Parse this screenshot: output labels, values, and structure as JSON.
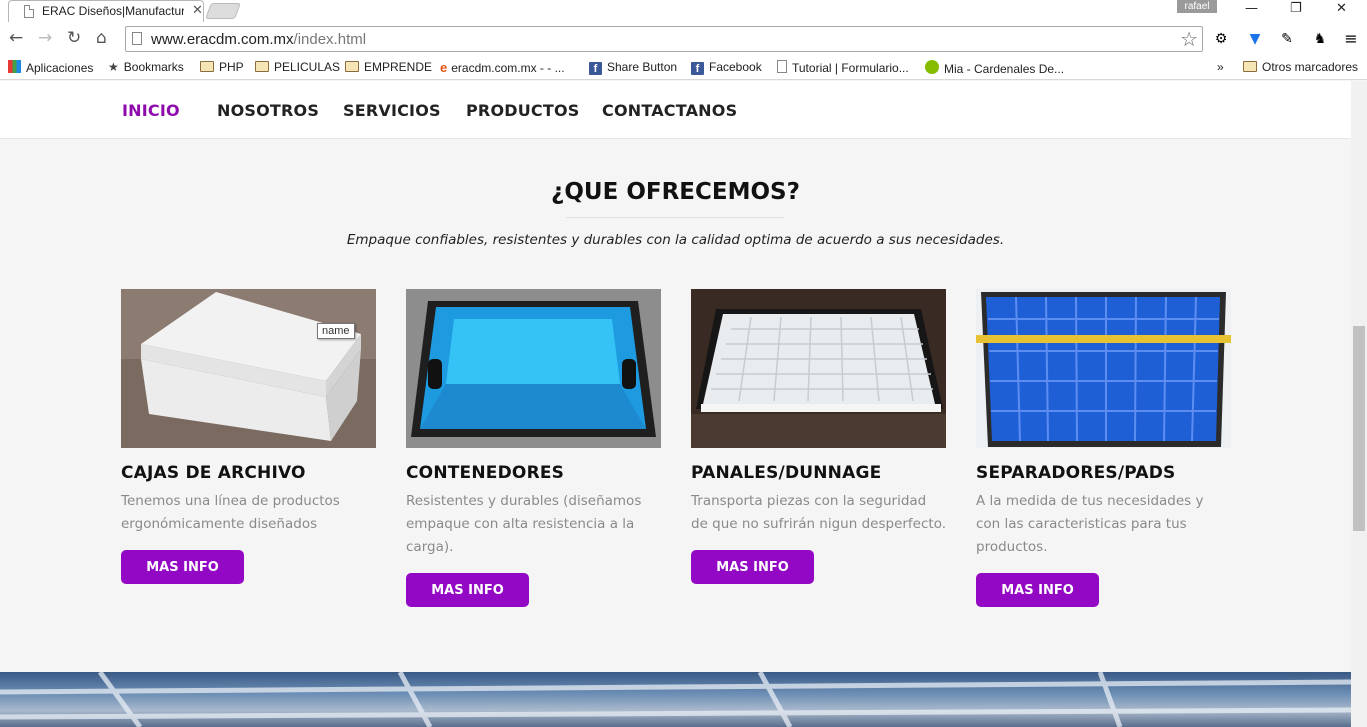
{
  "browser": {
    "tab_title": "ERAC Diseños|Manufactur",
    "user": "rafael",
    "url_domain": "www.eracdm.com.mx",
    "url_path": "/index.html",
    "bookmarks": [
      {
        "label": "Aplicaciones",
        "icon": "apps-icon"
      },
      {
        "label": "Bookmarks",
        "icon": "star-icon"
      },
      {
        "label": "PHP",
        "icon": "folder-icon"
      },
      {
        "label": "PELICULAS",
        "icon": "folder-icon"
      },
      {
        "label": "EMPRENDE",
        "icon": "folder-icon"
      },
      {
        "label": "eracdm.com.mx - - ...",
        "icon": "site-icon"
      },
      {
        "label": "Share Button",
        "icon": "facebook-icon"
      },
      {
        "label": "Facebook",
        "icon": "facebook-icon"
      },
      {
        "label": "Tutorial | Formulario...",
        "icon": "page-icon"
      },
      {
        "label": "Mia - Cardenales De...",
        "icon": "spotify-icon"
      }
    ],
    "overflow": "»",
    "other_bookmarks": "Otros marcadores"
  },
  "nav": {
    "items": [
      "INICIO",
      "NOSOTROS",
      "SERVICIOS",
      "PRODUCTOS",
      "CONTACTANOS"
    ],
    "active": "INICIO"
  },
  "section": {
    "title": "¿QUE OFRECEMOS?",
    "subtitle": "Empaque confiables, resistentes y durables con la calidad optima de acuerdo a sus necesidades."
  },
  "cards": [
    {
      "title": "CAJAS DE ARCHIVO",
      "text": "Tenemos una línea de productos ergonómicamente diseñados",
      "button": "MAS INFO"
    },
    {
      "title": "CONTENEDORES",
      "text": "Resistentes y durables (diseñamos empaque con alta resistencia a la carga).",
      "button": "MAS INFO"
    },
    {
      "title": "PANALES/DUNNAGE",
      "text": "Transporta piezas con la seguridad de que no sufrirán nigun desperfecto.",
      "button": "MAS INFO"
    },
    {
      "title": "SEPARADORES/PADS",
      "text": "A la medida de tus necesidades y con las caracteristicas para tus productos.",
      "button": "MAS INFO"
    }
  ],
  "tooltip": "name",
  "colors": {
    "accent": "#9308c4",
    "active_nav": "#8e0aad"
  }
}
